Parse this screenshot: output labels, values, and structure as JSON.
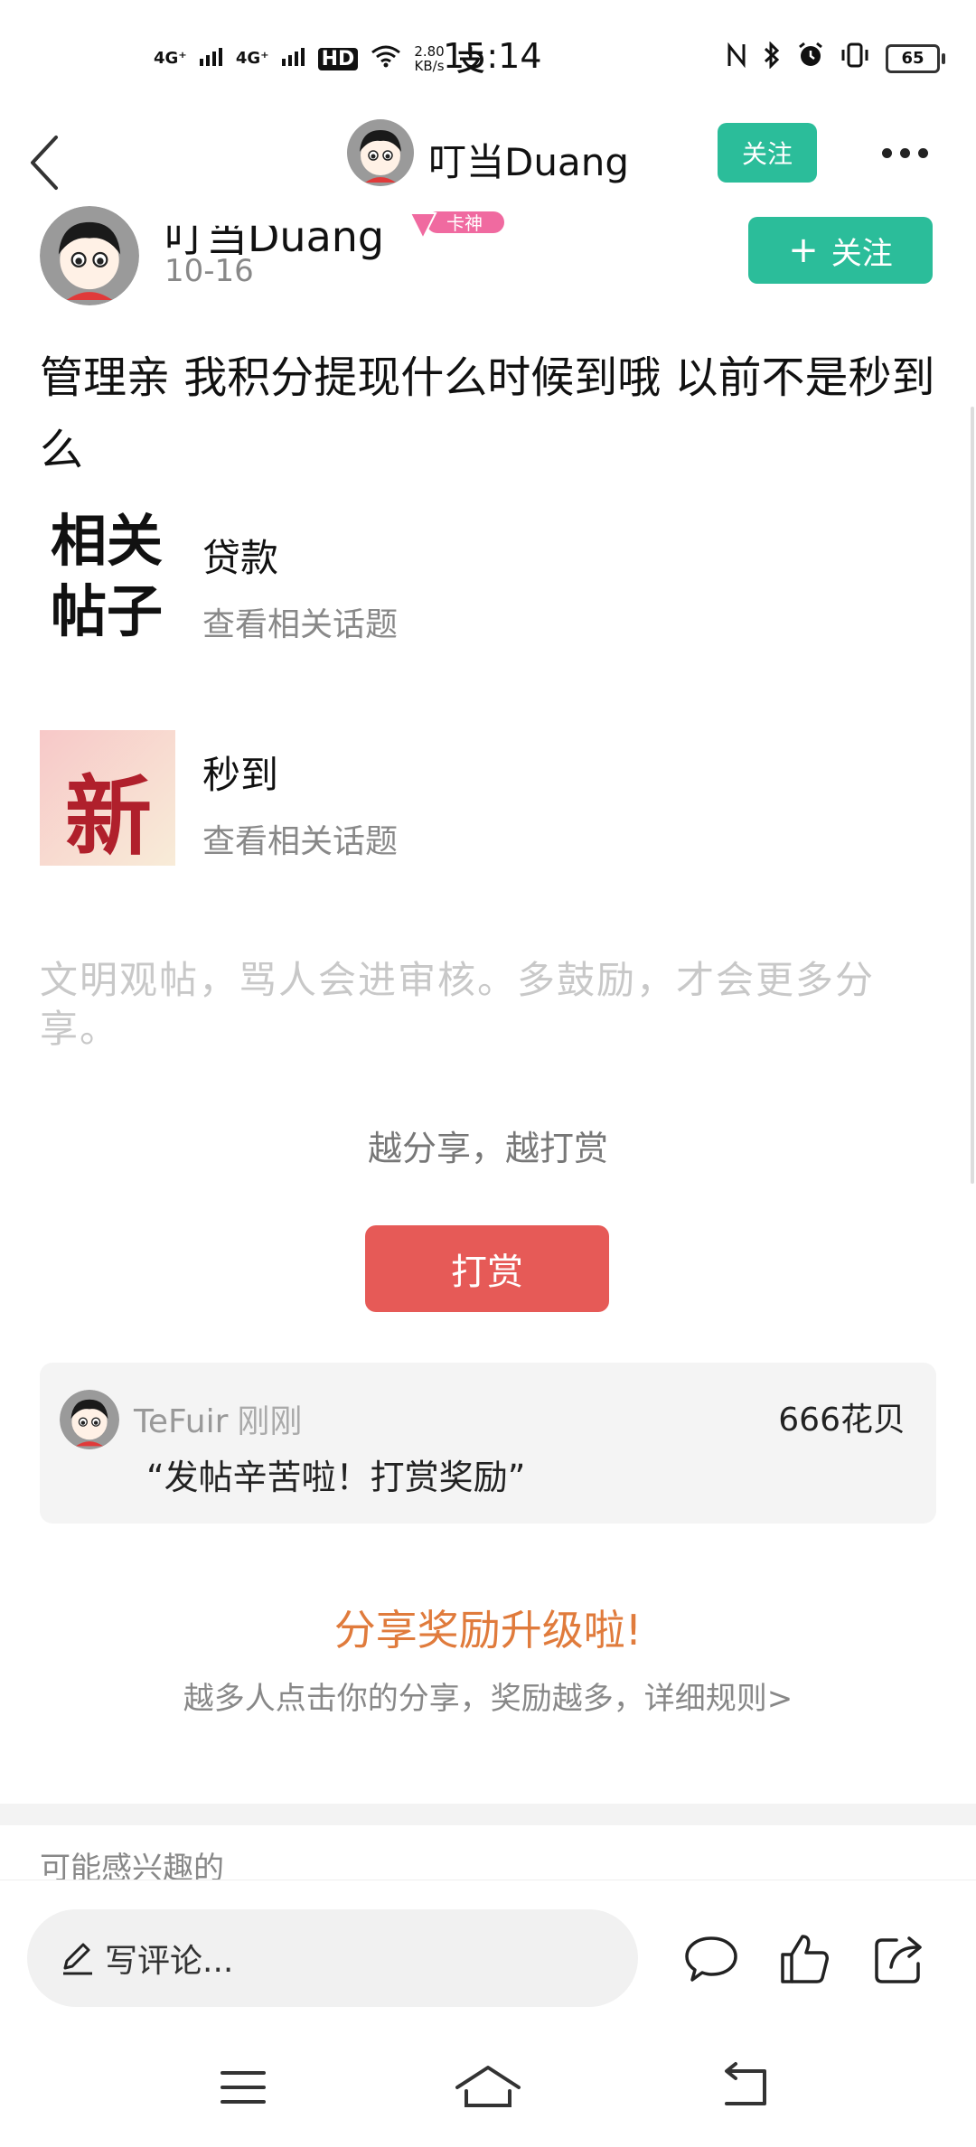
{
  "status_bar": {
    "signal1": "4G⁺",
    "signal2": "4G⁺",
    "hd": "HD",
    "speed": "2.80",
    "speed_unit": "KB/s",
    "pay_icon": "支",
    "time": "15:14",
    "battery": "65"
  },
  "nav": {
    "title": "叮当Duang",
    "follow_label": "关注"
  },
  "author": {
    "name": "叮当Duang",
    "badge": "卡神",
    "date": "10-16",
    "follow_label": "关注"
  },
  "post": {
    "text": "管理亲 我积分提现什么时候到哦 以前不是秒到么"
  },
  "related": {
    "calligraphy_line1": "相关",
    "calligraphy_line2": "帖子",
    "topics": [
      {
        "title": "贷款",
        "subtitle": "查看相关话题"
      },
      {
        "title": "秒到",
        "subtitle": "查看相关话题",
        "image_text": "新"
      }
    ]
  },
  "civil_notice": "文明观帖，骂人会进审核。多鼓励，才会更多分享。",
  "share_hint": "越分享，越打赏",
  "reward_button": "打赏",
  "reward_record": {
    "user": "TeFuir",
    "time": "刚刚",
    "amount": "666花贝",
    "message": "“发帖辛苦啦！打赏奖励”"
  },
  "upgrade": {
    "title": "分享奖励升级啦!",
    "subtitle": "越多人点击你的分享，奖励越多，详细规则>"
  },
  "interest_label": "可能感兴趣的",
  "bottom_bar": {
    "comment_placeholder": "写评论..."
  },
  "colors": {
    "accent_green": "#2bbd9a",
    "reward_red": "#e65a57",
    "upgrade_orange": "#e07b3c"
  }
}
